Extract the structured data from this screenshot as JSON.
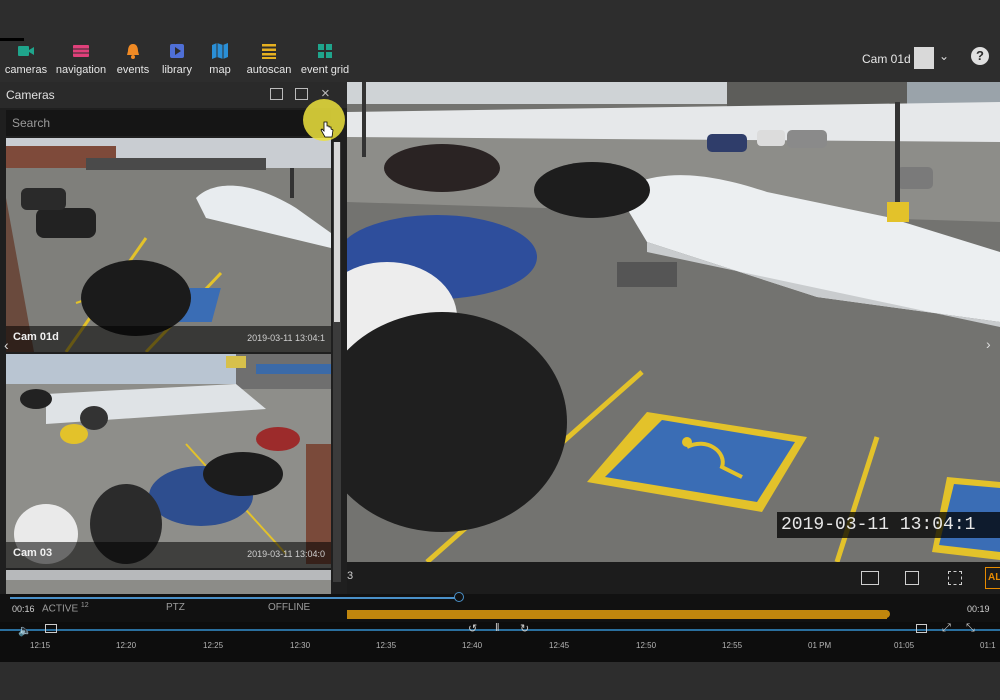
{
  "nav": {
    "items": [
      {
        "label": "cameras",
        "icon": "camera-icon",
        "color": "#1fa58c"
      },
      {
        "label": "navigation",
        "icon": "navigation-grid-icon",
        "color": "#e0407a"
      },
      {
        "label": "events",
        "icon": "bell-icon",
        "color": "#f08a24"
      },
      {
        "label": "library",
        "icon": "library-play-icon",
        "color": "#4f6fd6"
      },
      {
        "label": "map",
        "icon": "map-icon",
        "color": "#2a8fd6"
      },
      {
        "label": "autoscan",
        "icon": "autoscan-list-icon",
        "color": "#e6b020"
      },
      {
        "label": "event grid",
        "icon": "grid-icon",
        "color": "#1fa58c"
      }
    ]
  },
  "camera_selector": {
    "value": "Cam 01d"
  },
  "help": {
    "label": "?"
  },
  "panel": {
    "title": "Cameras",
    "search_placeholder": "Search",
    "thumbnails": [
      {
        "name": "Cam 01d",
        "stamp": "2019-03-11 13:04:1"
      },
      {
        "name": "Cam 03",
        "stamp": "2019-03-11 13:04:0"
      }
    ]
  },
  "player": {
    "timestamp": "2019-03-11 13:04:1",
    "elapsed": "00:16",
    "end": "00:19",
    "partial_label": "3",
    "alarm_label": "AL"
  },
  "status_tabs": [
    {
      "label": "ACTIVE",
      "count": "12"
    },
    {
      "label": "PTZ"
    },
    {
      "label": "OFFLINE"
    }
  ],
  "timeline": {
    "ticks": [
      "12:15",
      "12:20",
      "12:25",
      "12:30",
      "12:35",
      "12:40",
      "12:45",
      "12:50",
      "12:55",
      "01 PM",
      "01:05",
      "01:1"
    ],
    "progress_fraction": 0.45
  },
  "colors": {
    "accent_blue": "#4a90c8",
    "recording_bar": "#c0860d",
    "alarm": "#e68a00",
    "cursor_highlight": "#ece23c"
  }
}
